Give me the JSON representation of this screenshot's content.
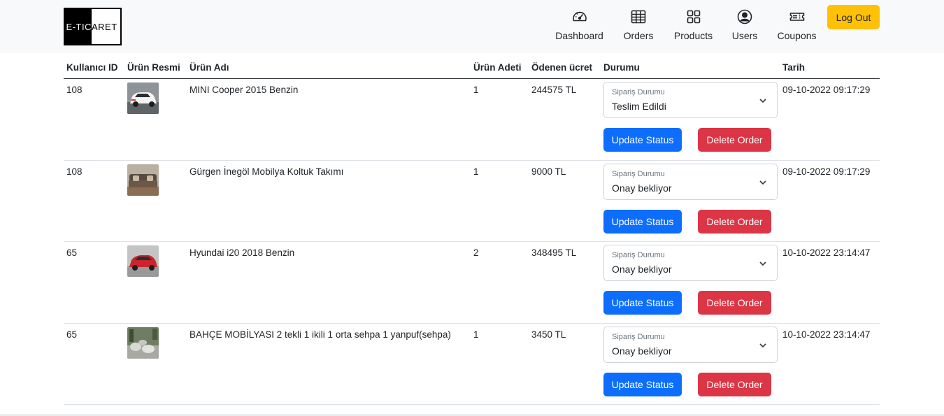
{
  "brand": {
    "left": "E-TIC",
    "right": "ARET"
  },
  "nav": [
    {
      "label": "Dashboard",
      "icon": "speedometer-icon"
    },
    {
      "label": "Orders",
      "icon": "table-grid-icon"
    },
    {
      "label": "Products",
      "icon": "grid-squares-icon"
    },
    {
      "label": "Users",
      "icon": "user-circle-icon"
    },
    {
      "label": "Coupons",
      "icon": "ticket-icon"
    }
  ],
  "logout_label": "Log Out",
  "columns": [
    "Kullanıcı ID",
    "Ürün Resmi",
    "Ürün Adı",
    "Ürün Adeti",
    "Ödenen ücret",
    "Durumu",
    "Tarih"
  ],
  "select_caption": "Sipariş Durumu",
  "update_label": "Update Status",
  "delete_label": "Delete Order",
  "orders": [
    {
      "user_id": "108",
      "product": "MINI Cooper 2015 Benzin",
      "qty": "1",
      "paid": "244575 TL",
      "status": "Teslim Edildi",
      "date": "09-10-2022 09:17:29",
      "image": "car-white-thumbnail"
    },
    {
      "user_id": "108",
      "product": "Gürgen İnegöl Mobilya Koltuk Takımı",
      "qty": "1",
      "paid": "9000 TL",
      "status": "Onay bekliyor",
      "date": "09-10-2022 09:17:29",
      "image": "sofa-thumbnail"
    },
    {
      "user_id": "65",
      "product": "Hyundai i20 2018 Benzin",
      "qty": "2",
      "paid": "348495 TL",
      "status": "Onay bekliyor",
      "date": "10-10-2022 23:14:47",
      "image": "car-red-thumbnail"
    },
    {
      "user_id": "65",
      "product": "BAHÇE MOBİLYASI 2 tekli 1 ikili 1 orta sehpa 1 yanpuf(sehpa)",
      "qty": "1",
      "paid": "3450 TL",
      "status": "Onay bekliyor",
      "date": "10-10-2022 23:14:47",
      "image": "garden-furniture-thumbnail"
    }
  ],
  "colors": {
    "primary": "#0d6efd",
    "danger": "#dc3545",
    "warning": "#ffc107",
    "navbar_bg": "#f8f9fa"
  }
}
